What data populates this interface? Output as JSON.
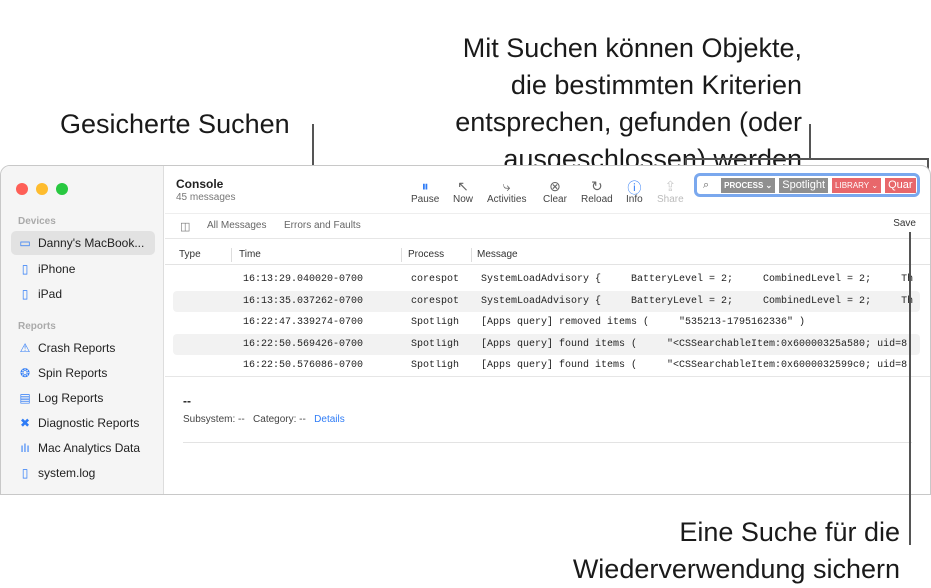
{
  "callouts": {
    "saved_searches": "Gesicherte Suchen",
    "search_desc": [
      "Mit Suchen können Objekte,",
      "die bestimmten Kriterien",
      "entsprechen, gefunden (oder",
      "ausgeschlossen) werden"
    ],
    "save_search": [
      "Eine Suche für die",
      "Wiederverwendung sichern"
    ]
  },
  "sidebar": {
    "devices_label": "Devices",
    "devices": [
      {
        "label": "Danny's MacBook...",
        "icon": "laptop-icon"
      },
      {
        "label": "iPhone",
        "icon": "iphone-icon"
      },
      {
        "label": "iPad",
        "icon": "ipad-icon"
      }
    ],
    "reports_label": "Reports",
    "reports": [
      {
        "label": "Crash Reports",
        "icon": "warning-icon"
      },
      {
        "label": "Spin Reports",
        "icon": "spin-icon"
      },
      {
        "label": "Log Reports",
        "icon": "log-icon"
      },
      {
        "label": "Diagnostic Reports",
        "icon": "tools-icon"
      },
      {
        "label": "Mac Analytics Data",
        "icon": "chart-icon"
      },
      {
        "label": "system.log",
        "icon": "document-icon"
      }
    ]
  },
  "header": {
    "title": "Console",
    "subtitle": "45 messages"
  },
  "toolbar": {
    "pause": "Pause",
    "now": "Now",
    "activities": "Activities",
    "clear": "Clear",
    "reload": "Reload",
    "info": "Info",
    "share": "Share"
  },
  "search": {
    "token1_type": "PROCESS",
    "token1_value": "Spotlight",
    "token2_type": "LIBRARY",
    "token2_value": "Quar",
    "colors": {
      "process": "#8f8f8f",
      "library": "#e8676b",
      "focus": "#7aa8ee"
    }
  },
  "filters": {
    "all": "All Messages",
    "errors": "Errors and Faults",
    "save": "Save"
  },
  "table": {
    "columns": [
      "Type",
      "Time",
      "Process",
      "Message"
    ],
    "rows": [
      {
        "time": "16:13:29.040020-0700",
        "process": "corespot",
        "message": "SystemLoadAdvisory {     BatteryLevel = 2;     CombinedLevel = 2;     Th"
      },
      {
        "time": "16:13:35.037262-0700",
        "process": "corespot",
        "message": "SystemLoadAdvisory {     BatteryLevel = 2;     CombinedLevel = 2;     Th"
      },
      {
        "time": "16:22:47.339274-0700",
        "process": "Spotligh",
        "message": "[Apps query] removed items (     \"535213-1795162336\" )"
      },
      {
        "time": "16:22:50.569426-0700",
        "process": "Spotligh",
        "message": "[Apps query] found items (     \"<CSSearchableItem:0x60000325a580; uid=8"
      },
      {
        "time": "16:22:50.576086-0700",
        "process": "Spotligh",
        "message": "[Apps query] found items (     \"<CSSearchableItem:0x6000032599c0; uid=8"
      }
    ]
  },
  "detail": {
    "title": "--",
    "subsystem": "Subsystem: --",
    "category": "Category: --",
    "details_link": "Details"
  }
}
